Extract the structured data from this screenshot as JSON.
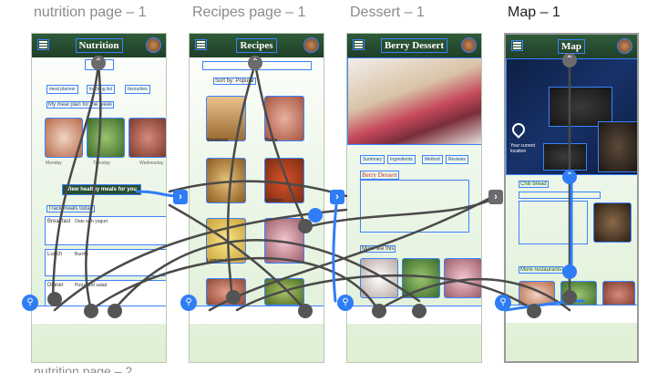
{
  "frames": [
    {
      "label": "nutrition page – 1"
    },
    {
      "label": "Recipes page – 1"
    },
    {
      "label": "Dessert – 1"
    },
    {
      "label": "Map – 1"
    }
  ],
  "next_frame_label": "nutrition page – 2",
  "nutrition": {
    "title": "Nutrition",
    "tabs": [
      "meal planner",
      "tracking list",
      "favourites"
    ],
    "subhead": "My meal plan for the week",
    "days": [
      "Monday",
      "Tuesday",
      "Wednesday"
    ],
    "cta": "View healthy meals for you",
    "track_label": "Track meals today",
    "meals": [
      {
        "slot": "Breakfast",
        "dish": "Oats with yogurt"
      },
      {
        "slot": "Lunch",
        "dish": "Burrito"
      },
      {
        "slot": "Dinner",
        "dish": "Pizza and salad"
      }
    ]
  },
  "recipes": {
    "title": "Recipes",
    "sort_label": "Sort by: Popular",
    "items": [
      "Sandwich",
      "Pasta",
      "",
      "Chicken",
      "Lemonade",
      "",
      "",
      ""
    ]
  },
  "dessert": {
    "title": "Berry Dessert",
    "tabs": [
      "Summary",
      "Ingredients",
      "Method",
      "Reviews"
    ],
    "heading": "Berry Dessert",
    "more_label": "More like this"
  },
  "map": {
    "title": "Map",
    "location_label": "Your current location",
    "place_name": "Chili bread",
    "more_label": "More restaurants"
  },
  "colors": {
    "accent": "#2f7df6",
    "appbar": "#264e33",
    "connector": "#4a4a4a",
    "selection": "#3b82ff"
  }
}
